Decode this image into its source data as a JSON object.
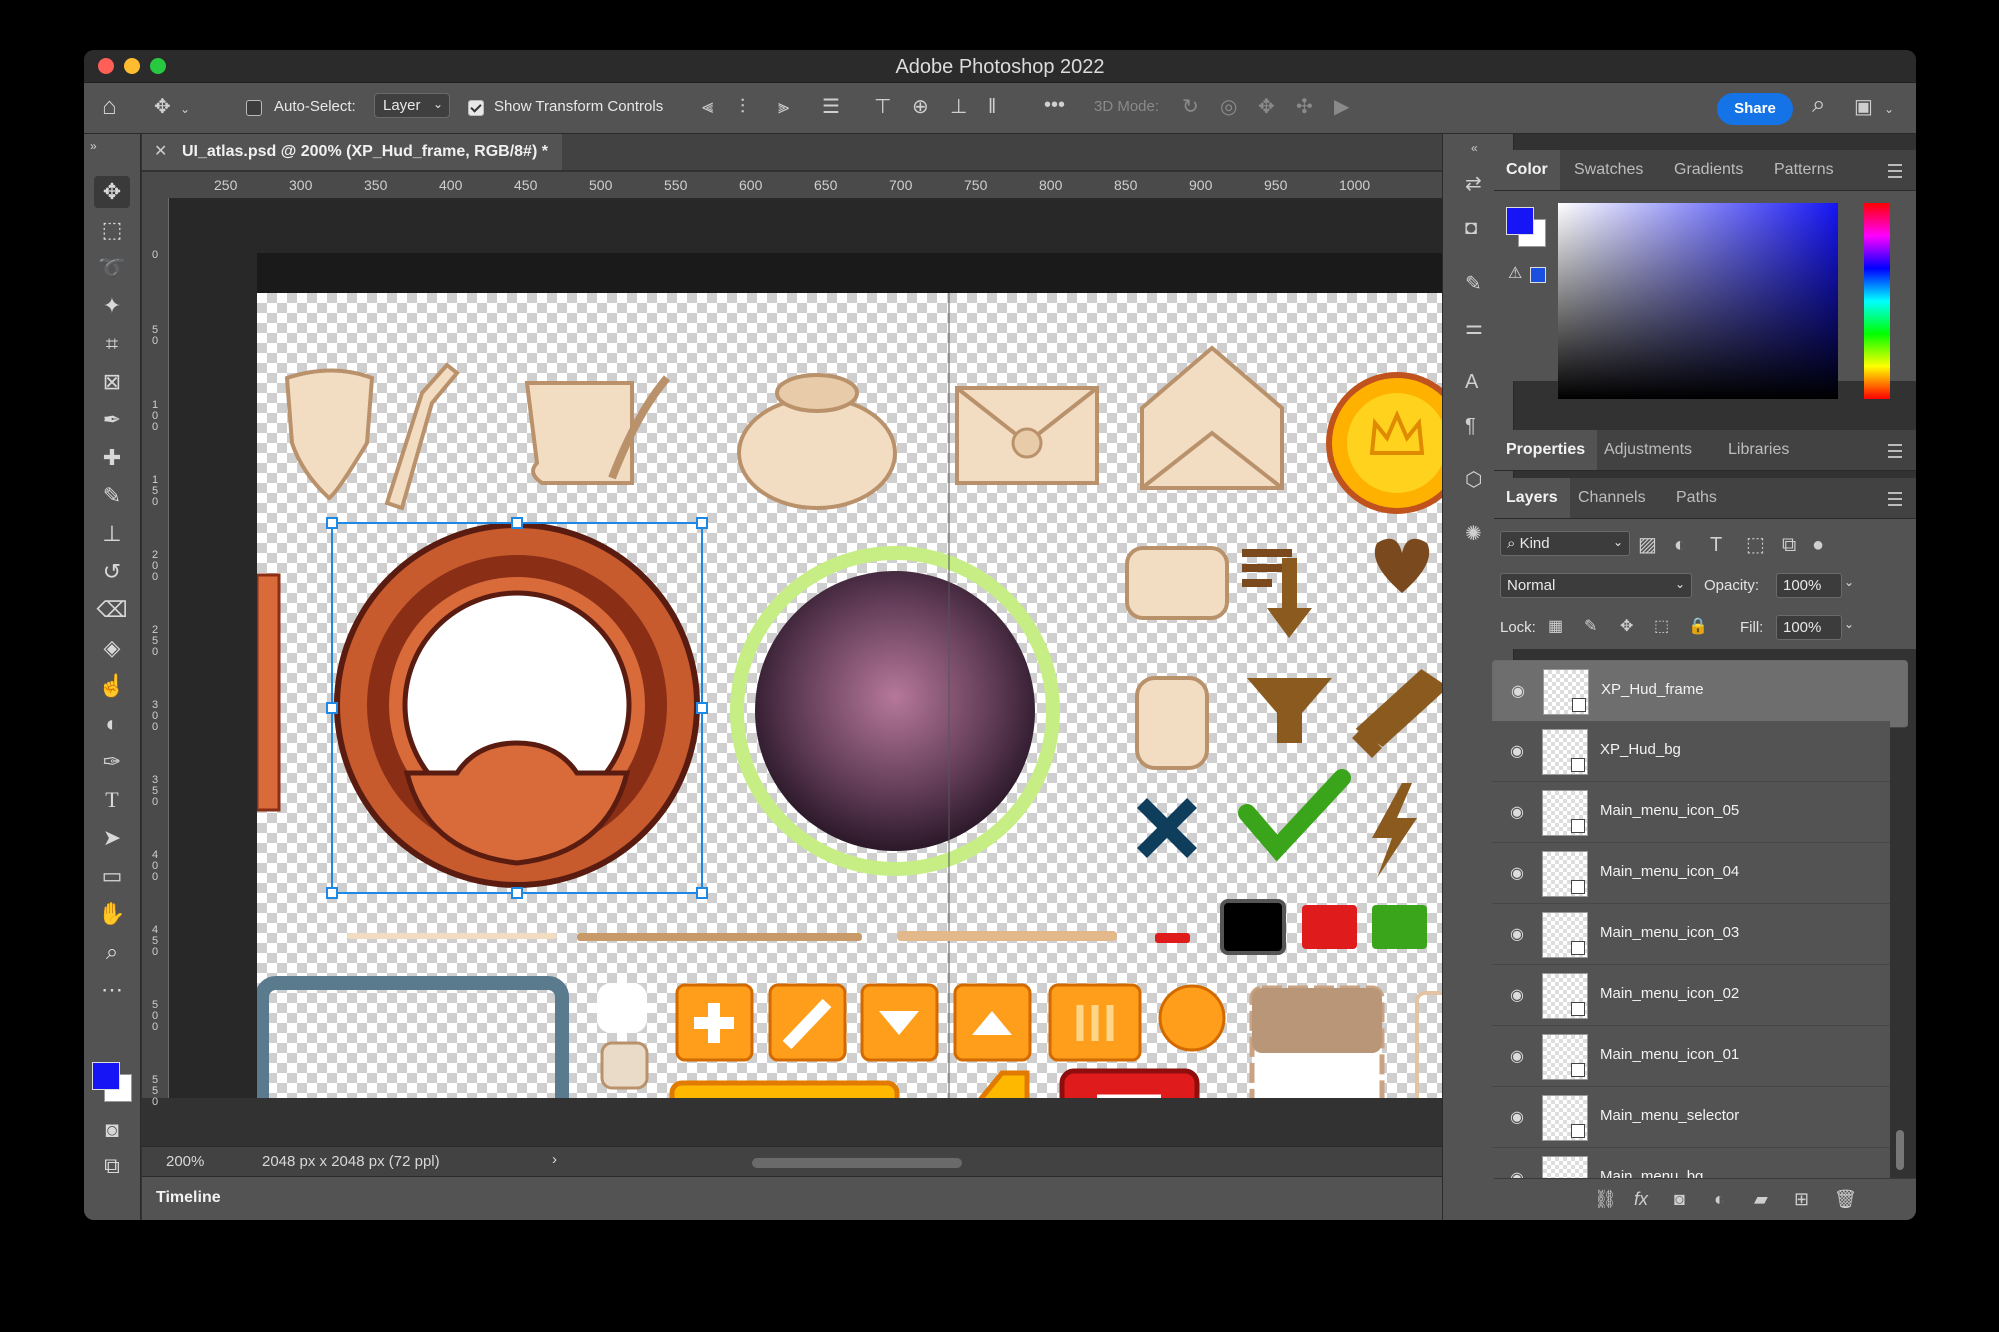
{
  "window": {
    "title": "Adobe Photoshop 2022"
  },
  "options_bar": {
    "auto_select_label": "Auto-Select:",
    "auto_select_value": "Layer",
    "show_transform_label": "Show Transform Controls",
    "mode_3d_label": "3D Mode:",
    "share_label": "Share"
  },
  "document": {
    "tab_title": "UI_atlas.psd @ 200% (XP_Hud_frame, RGB/8#) *",
    "zoom": "200%",
    "size_info": "2048 px x 2048 px (72 ppl)"
  },
  "ruler": {
    "h_labels": [
      "250",
      "300",
      "350",
      "400",
      "450",
      "500",
      "550",
      "600",
      "650",
      "700",
      "750",
      "800",
      "850",
      "900",
      "950",
      "1000"
    ],
    "v_labels": [
      "0",
      "50",
      "100",
      "150",
      "200",
      "250",
      "300",
      "350",
      "400",
      "450",
      "500",
      "550"
    ]
  },
  "timeline": {
    "label": "Timeline"
  },
  "color_panel": {
    "tabs": [
      "Color",
      "Swatches",
      "Gradients",
      "Patterns"
    ],
    "foreground": "#1515f5",
    "background": "#ffffff"
  },
  "properties_panel": {
    "tabs": [
      "Properties",
      "Adjustments",
      "Libraries"
    ]
  },
  "layers_panel": {
    "tabs": [
      "Layers",
      "Channels",
      "Paths"
    ],
    "filter_label": "Kind",
    "blend_mode": "Normal",
    "opacity_label": "Opacity:",
    "opacity_value": "100%",
    "lock_label": "Lock:",
    "fill_label": "Fill:",
    "fill_value": "100%",
    "layers": [
      {
        "name": "XP_Hud_frame",
        "selected": true
      },
      {
        "name": "XP_Hud_bg",
        "selected": false
      },
      {
        "name": "Main_menu_icon_05",
        "selected": false
      },
      {
        "name": "Main_menu_icon_04",
        "selected": false
      },
      {
        "name": "Main_menu_icon_03",
        "selected": false
      },
      {
        "name": "Main_menu_icon_02",
        "selected": false
      },
      {
        "name": "Main_menu_icon_01",
        "selected": false
      },
      {
        "name": "Main_menu_selector",
        "selected": false
      },
      {
        "name": "Main_menu_bg",
        "selected": false
      }
    ]
  },
  "tools": [
    "move-tool",
    "marquee-tool",
    "lasso-tool",
    "magic-wand-tool",
    "crop-tool",
    "frame-tool",
    "eyedropper-tool",
    "healing-tool",
    "brush-tool",
    "stamp-tool",
    "history-brush-tool",
    "eraser-tool",
    "paint-bucket-tool",
    "smudge-tool",
    "dodge-tool",
    "pen-tool",
    "type-tool",
    "path-select-tool",
    "rectangle-tool",
    "hand-tool",
    "zoom-tool",
    "more-tools"
  ],
  "colors": {
    "accent": "#1473e6",
    "selection": "#1e88e5"
  }
}
